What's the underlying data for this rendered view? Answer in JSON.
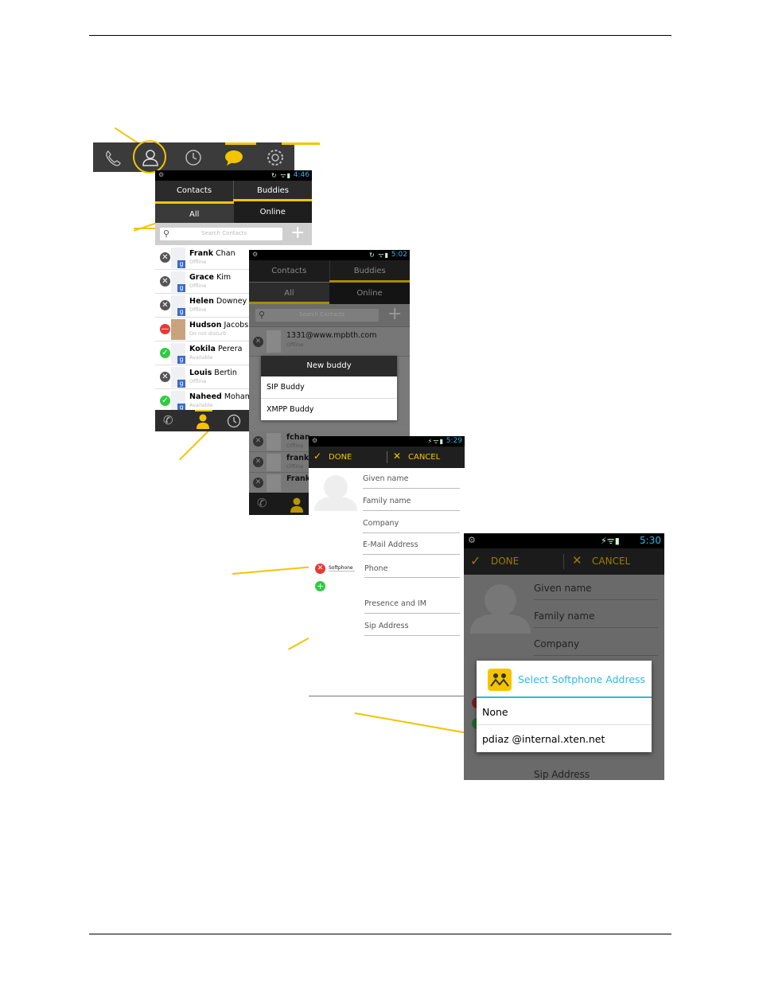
{
  "tabbar": {
    "icons": [
      "phone-icon",
      "contacts-icon",
      "history-icon",
      "messages-icon",
      "settings-icon"
    ]
  },
  "screen1": {
    "status_time": "4:46",
    "tabs": [
      "Contacts",
      "Buddies"
    ],
    "subtabs": [
      "All",
      "Online"
    ],
    "search_placeholder": "Search Contacts",
    "add_label": "+",
    "contacts": [
      {
        "first": "Frank",
        "last": "Chan",
        "status": "Offline",
        "state": "offline"
      },
      {
        "first": "Grace",
        "last": "Kim",
        "status": "Offline",
        "state": "offline"
      },
      {
        "first": "Helen",
        "last": "Downey",
        "status": "Offline",
        "state": "offline"
      },
      {
        "first": "Hudson",
        "last": "Jacobs",
        "status": "Do not disturb",
        "state": "dnd"
      },
      {
        "first": "Kokila",
        "last": "Perera",
        "status": "Available",
        "state": "available"
      },
      {
        "first": "Louis",
        "last": "Bertin",
        "status": "Offline",
        "state": "offline"
      },
      {
        "first": "Naheed",
        "last": "Mohamm",
        "status": "Available",
        "state": "available"
      }
    ]
  },
  "screen2": {
    "status_time": "5:02",
    "tabs": [
      "Contacts",
      "Buddies"
    ],
    "subtabs": [
      "All",
      "Online"
    ],
    "search_placeholder": "Search Contacts",
    "first_buddy": "1331@www.mpbth.com",
    "first_buddy_status": "Offline",
    "dialog_title": "New buddy",
    "dialog_options": [
      "SIP Buddy",
      "XMPP Buddy"
    ],
    "bottom_rows": [
      {
        "name": "fchan",
        "status": "Offline"
      },
      {
        "name": "frank",
        "status": "Offline"
      },
      {
        "name": "Frank",
        "status": ""
      }
    ]
  },
  "screen3": {
    "status_time": "5:29",
    "done_label": "DONE",
    "cancel_label": "CANCEL",
    "fields": [
      "Given name",
      "Family name",
      "Company",
      "E-Mail Address",
      "Phone",
      "Presence and IM",
      "Sip Address"
    ],
    "softphone_label": "Softphone"
  },
  "screen4": {
    "status_time": "5:30",
    "done_label": "DONE",
    "cancel_label": "CANCEL",
    "fields": [
      "Given name",
      "Family name",
      "Company",
      "Sip Address"
    ],
    "dialog_title": "Select Softphone Address",
    "options": [
      "None",
      "pdiaz @internal.xten.net"
    ]
  },
  "colors": {
    "accent": "#f4c400",
    "dark": "#1f1f1f",
    "holo_blue": "#33b5e5"
  }
}
